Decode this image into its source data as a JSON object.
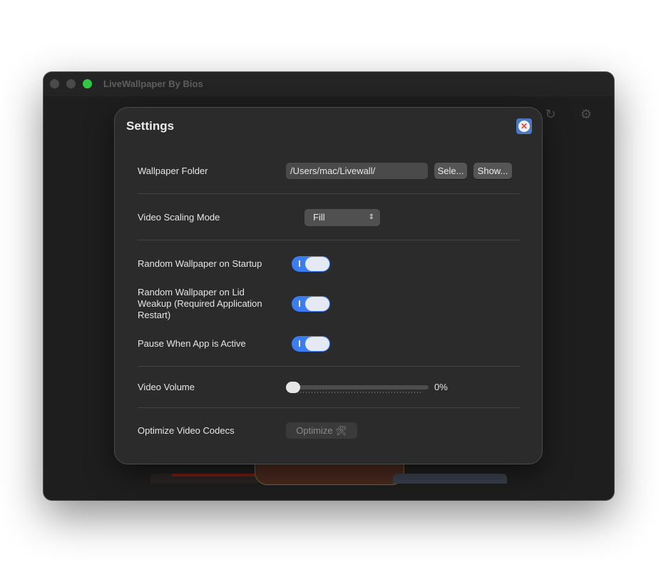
{
  "window": {
    "title": "LiveWallpaper By Bios"
  },
  "toolbar": {
    "refresh_icon": "↻",
    "settings_icon": "⚙"
  },
  "settings": {
    "title": "Settings",
    "close_icon": "✕",
    "wallpaper_folder": {
      "label": "Wallpaper Folder",
      "path": "/Users/mac/Livewall/",
      "select_label": "Sele...",
      "show_label": "Show..."
    },
    "video_scaling": {
      "label": "Video Scaling Mode",
      "value": "Fill",
      "chevron": "⌃⌄"
    },
    "random_startup": {
      "label": "Random Wallpaper on Startup",
      "on": true
    },
    "random_lid": {
      "label_line1": "Random Wallpaper on Lid",
      "label_line2": "Weakup (Required Application",
      "label_line3": "Restart)",
      "on": true
    },
    "pause_active": {
      "label": "Pause When App is Active",
      "on": true
    },
    "video_volume": {
      "label": "Video Volume",
      "value": 0,
      "value_text": "0%"
    },
    "optimize": {
      "label": "Optimize Video Codecs",
      "button_label": "Optimize",
      "button_icon": "🛠"
    }
  },
  "colors": {
    "accent": "#3b7cf0",
    "zoom_button": "#33c748",
    "close_icon": "#e0443e"
  }
}
